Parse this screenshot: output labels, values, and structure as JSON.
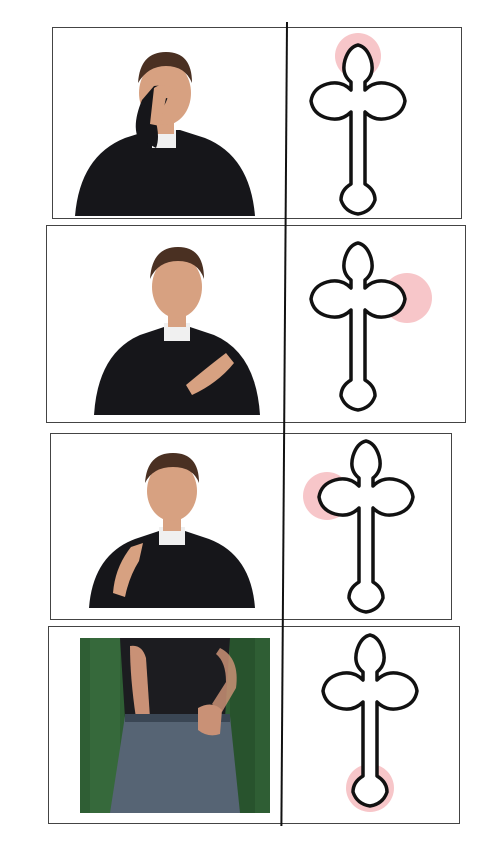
{
  "meme": {
    "rows": [
      {
        "photo": "priest-touching-forehead",
        "highlight": "top"
      },
      {
        "photo": "priest-touching-right-shoulder",
        "highlight": "right"
      },
      {
        "photo": "priest-touching-left-shoulder",
        "highlight": "left"
      },
      {
        "photo": "man-touching-crotch",
        "highlight": "bottom"
      }
    ],
    "colors": {
      "highlight": "#f7c6c9",
      "cross_stroke": "#111111",
      "frame": "#444444",
      "robe": "#16161a",
      "skin": "#d7a181",
      "hair": "#4a3022",
      "collar": "#f0f0f0",
      "jeans": "#566474",
      "background_green": "#2f5e34"
    }
  }
}
